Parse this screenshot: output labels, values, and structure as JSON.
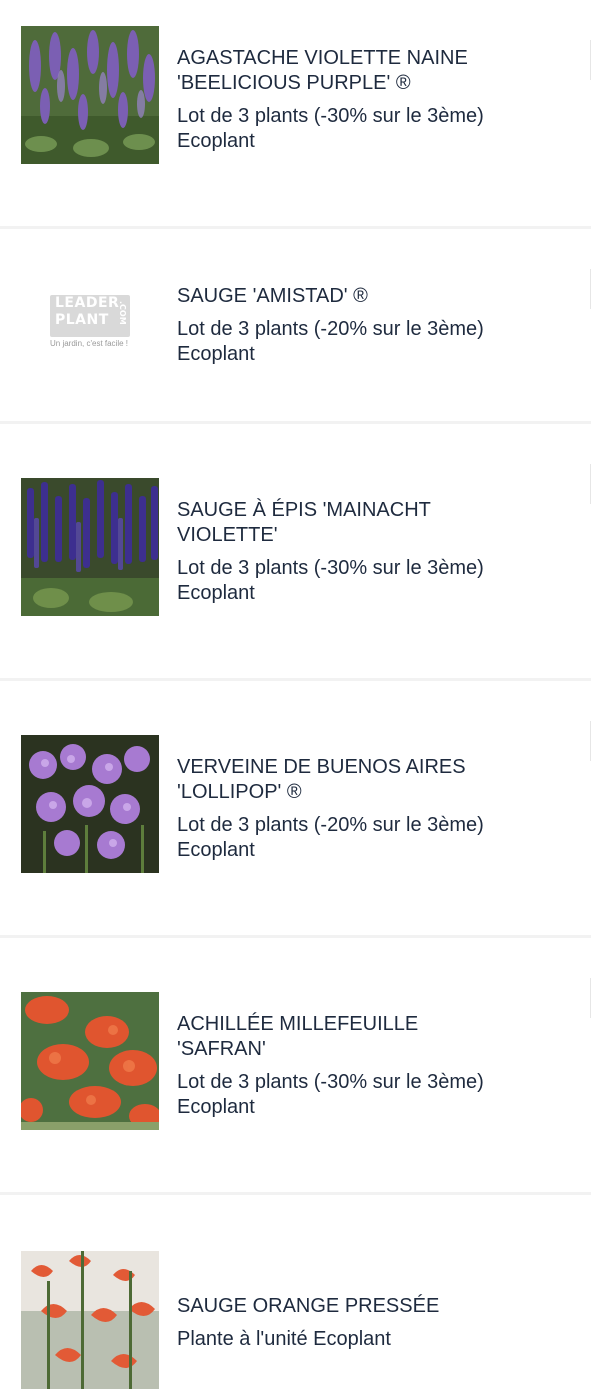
{
  "items": [
    {
      "title_lines": [
        "AGASTACHE VIOLETTE NAINE",
        "'BEELICIOUS PURPLE' ®"
      ],
      "offer": "Lot de 3 plants (-30% sur le 3ème)",
      "seller": "Ecoplant",
      "image": "purple-agastache-photo"
    },
    {
      "title_lines": [
        "SAUGE 'AMISTAD' ®"
      ],
      "offer": "Lot de 3 plants (-20% sur le 3ème)",
      "seller": "Ecoplant",
      "image": "leaderplant-logo-placeholder",
      "logo": {
        "line1": "LEADER",
        "line2": "PLANT",
        "suffix": ".COM",
        "tagline": "Un jardin, c'est facile !"
      }
    },
    {
      "title_lines": [
        "SAUGE À ÉPIS 'MAINACHT",
        "VIOLETTE'"
      ],
      "offer": "Lot de 3 plants (-30% sur le 3ème)",
      "seller": "Ecoplant",
      "image": "violet-salvia-photo"
    },
    {
      "title_lines": [
        "VERVEINE DE BUENOS AIRES",
        "'LOLLIPOP' ®"
      ],
      "offer": "Lot de 3 plants (-20% sur le 3ème)",
      "seller": "Ecoplant",
      "image": "verbena-flowers-photo"
    },
    {
      "title_lines": [
        "ACHILLÉE MILLEFEUILLE",
        "'SAFRAN'"
      ],
      "offer": "Lot de 3 plants (-30% sur le 3ème)",
      "seller": "Ecoplant",
      "image": "orange-yarrow-photo"
    },
    {
      "title_lines": [
        "SAUGE ORANGE PRESSÉE"
      ],
      "offer": "Plante à l'unité Ecoplant",
      "seller": "",
      "image": "orange-salvia-photo"
    }
  ],
  "colors": {
    "text": "#1e2a3e",
    "card": "#ffffff",
    "separator": "#f2f2f2"
  }
}
